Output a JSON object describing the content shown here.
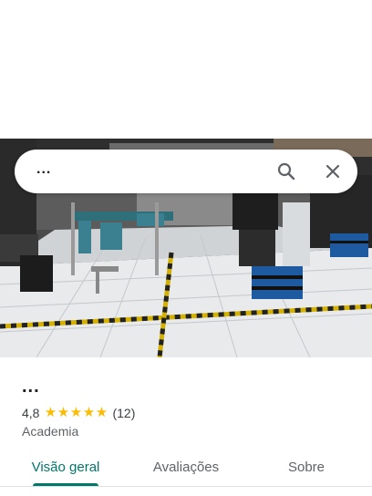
{
  "search": {
    "value": "..."
  },
  "place": {
    "name": "...",
    "rating": "4,8",
    "stars": 5,
    "review_count": "(12)",
    "category": "Academia"
  },
  "tabs": [
    {
      "label": "Visão geral",
      "active": true
    },
    {
      "label": "Avaliações",
      "active": false
    },
    {
      "label": "Sobre",
      "active": false
    }
  ],
  "colors": {
    "accent": "#00796b",
    "star": "#fbbc04",
    "text_primary": "#202124",
    "text_secondary": "#5f6368"
  },
  "icons": {
    "search": "search-icon",
    "close": "close-icon",
    "star": "star-icon"
  }
}
